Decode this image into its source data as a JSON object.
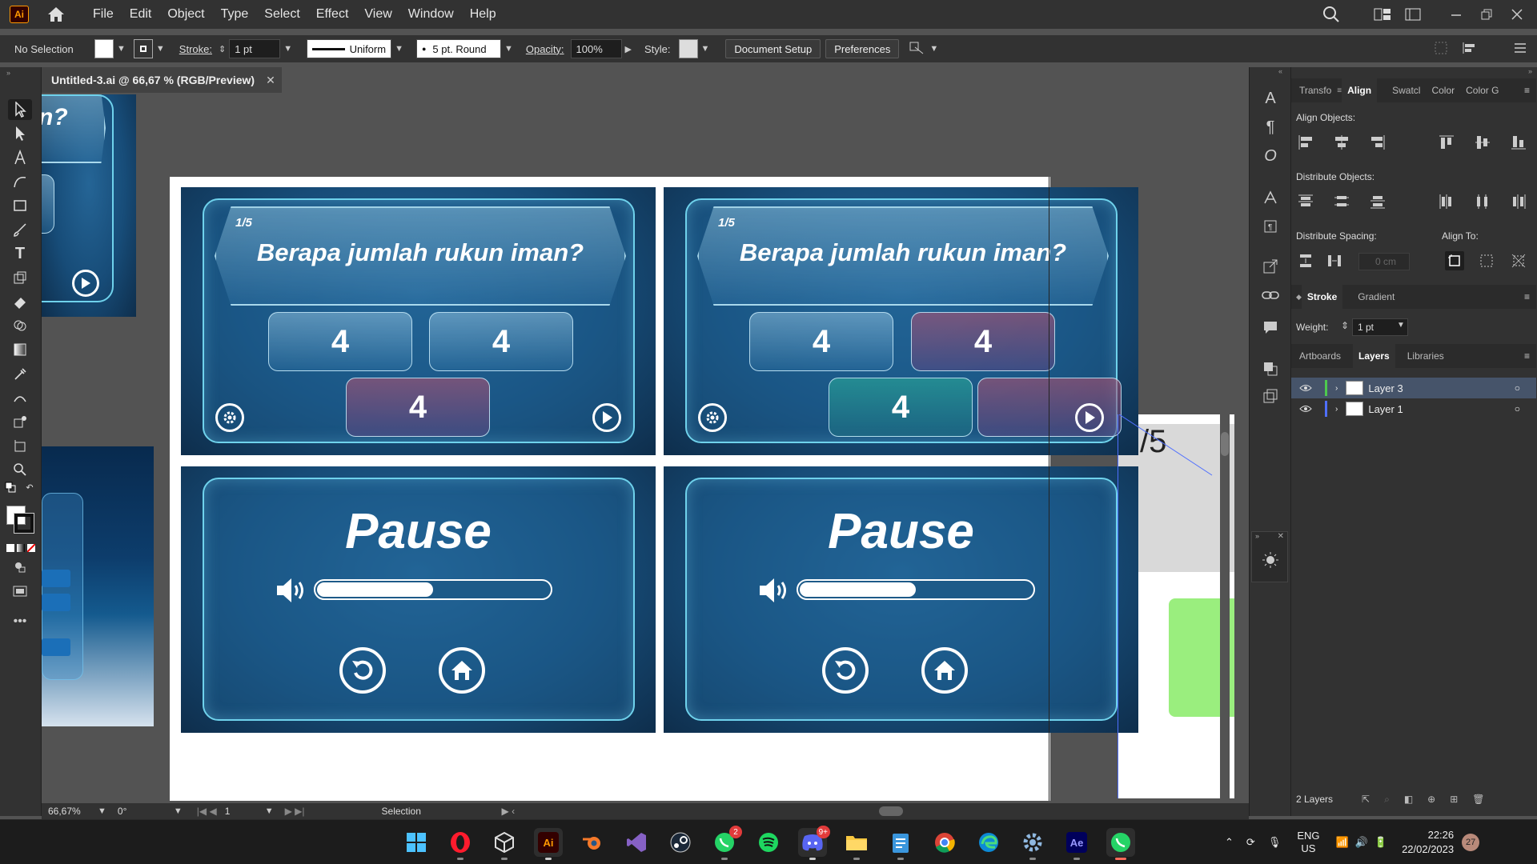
{
  "app": {
    "logo": "Ai"
  },
  "menu": [
    "File",
    "Edit",
    "Object",
    "Type",
    "Select",
    "Effect",
    "View",
    "Window",
    "Help"
  ],
  "control": {
    "selection": "No Selection",
    "stroke_label": "Stroke:",
    "stroke_value": "1 pt",
    "profile": "Uniform",
    "brush": "5 pt. Round",
    "opacity_label": "Opacity:",
    "opacity_value": "100%",
    "style_label": "Style:",
    "doc_setup": "Document Setup",
    "preferences": "Preferences"
  },
  "doc_tab": {
    "title": "Untitled-3.ai @ 66,67 % (RGB/Preview)",
    "close": "✕"
  },
  "artwork": {
    "partial_q": "n?",
    "question_counter": "1/5",
    "question": "Berapa jumlah rukun iman?",
    "answers": [
      "4",
      "4",
      "4"
    ],
    "pause_title": "Pause",
    "volume_level": 0.5,
    "overflow_counter": "/5"
  },
  "panels": {
    "tabs": [
      "Transfo",
      "Align",
      "Swatcl",
      "Color",
      "Color G"
    ],
    "active_tab": "Align",
    "align_objects": "Align Objects:",
    "distribute_objects": "Distribute Objects:",
    "distribute_spacing": "Distribute Spacing:",
    "align_to": "Align To:",
    "spacing_value": "0 cm",
    "stroke_tabs": [
      "Stroke",
      "Gradient"
    ],
    "weight_label": "Weight:",
    "weight_value": "1 pt",
    "layer_tabs": [
      "Artboards",
      "Layers",
      "Libraries"
    ],
    "layers": [
      {
        "name": "Layer 3",
        "color": "#4ec94e"
      },
      {
        "name": "Layer 1",
        "color": "#4f6fff"
      }
    ],
    "layers_count": "2 Layers"
  },
  "status": {
    "zoom": "66,67%",
    "rotation": "0°",
    "artboard": "1",
    "tool": "Selection"
  },
  "taskbar": {
    "whatsapp_badge": "2",
    "discord_badge": "9+",
    "lang": "ENG",
    "region": "US",
    "time": "22:26",
    "date": "22/02/2023",
    "notifications": "27"
  },
  "colors": {
    "accent_orange": "#ff9a00",
    "card_blue": "#174c78",
    "glow": "#6fd2ec",
    "green_block": "#9aee7e"
  }
}
